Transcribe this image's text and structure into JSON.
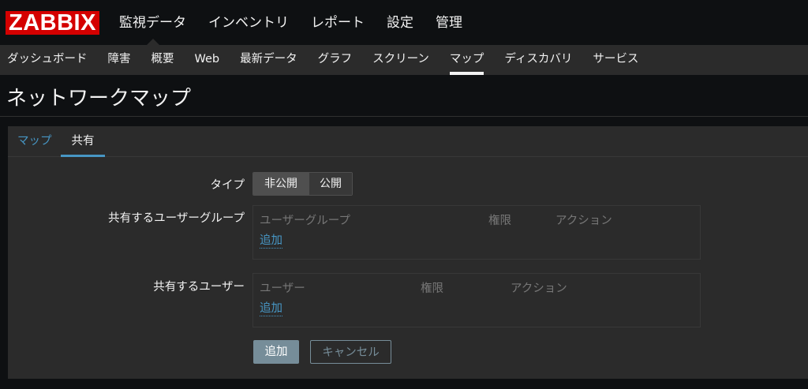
{
  "header": {
    "logo": "ZABBIX",
    "menu": [
      "監視データ",
      "インベントリ",
      "レポート",
      "設定",
      "管理"
    ]
  },
  "submenu": {
    "items": [
      "ダッシュボード",
      "障害",
      "概要",
      "Web",
      "最新データ",
      "グラフ",
      "スクリーン",
      "マップ",
      "ディスカバリ",
      "サービス"
    ],
    "active": "マップ"
  },
  "page": {
    "title": "ネットワークマップ"
  },
  "tabs": {
    "map": "マップ",
    "share": "共有"
  },
  "form": {
    "type_label": "タイプ",
    "type_options": [
      "非公開",
      "公開"
    ],
    "type_selected": "非公開",
    "groups": {
      "label": "共有するユーザーグループ",
      "col_group": "ユーザーグループ",
      "col_perm": "権限",
      "col_action": "アクション",
      "add": "追加"
    },
    "users": {
      "label": "共有するユーザー",
      "col_user": "ユーザー",
      "col_perm": "権限",
      "col_action": "アクション",
      "add": "追加"
    },
    "submit": "追加",
    "cancel": "キャンセル"
  },
  "colors": {
    "logo_red": "#d40000",
    "link_blue": "#4796c4",
    "panel": "#2b2b2b",
    "background": "#0e1012",
    "button": "#768d99"
  }
}
